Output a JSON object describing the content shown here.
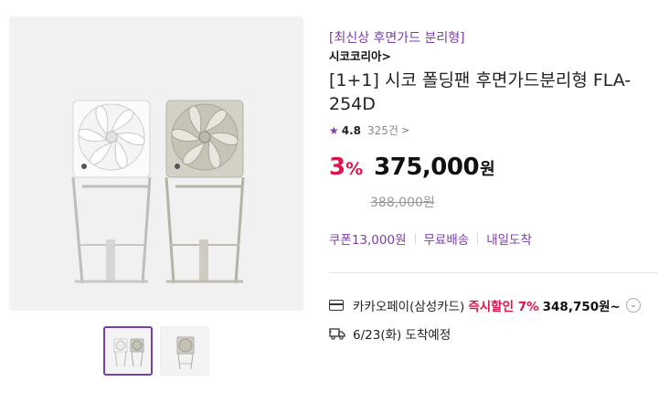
{
  "product": {
    "promo_tag": "[최신상 후면가드 분리형]",
    "brand": "시코코리아",
    "brand_chevron": ">",
    "title": "[1+1] 시코 폴딩팬 후면가드분리형 FLA-254D",
    "rating": {
      "star": "★",
      "score": "4.8",
      "review_count": "325건",
      "chevron": ">"
    },
    "price": {
      "discount_number": "3",
      "discount_pct": "%",
      "sale_price": "375,000",
      "currency": "원",
      "original_price": "388,000원"
    },
    "benefits": [
      {
        "label": "쿠폰13,000원"
      },
      {
        "label": "무료배송"
      },
      {
        "label": "내일도착"
      }
    ],
    "payment": {
      "name": "카카오페이(삼성카드)",
      "instant_label": "즉시할인 7%",
      "price": "348,750원~",
      "icon": "card-icon"
    },
    "shipping": {
      "text": "6/23(화) 도착예정",
      "icon": "truck-icon"
    }
  },
  "gallery": {
    "thumbnails": [
      {
        "name": "two-fans",
        "selected": true
      },
      {
        "name": "single-fan",
        "selected": false
      }
    ]
  },
  "colors": {
    "accent_purple": "#7a3ea8",
    "discount_red": "#e0144c"
  }
}
